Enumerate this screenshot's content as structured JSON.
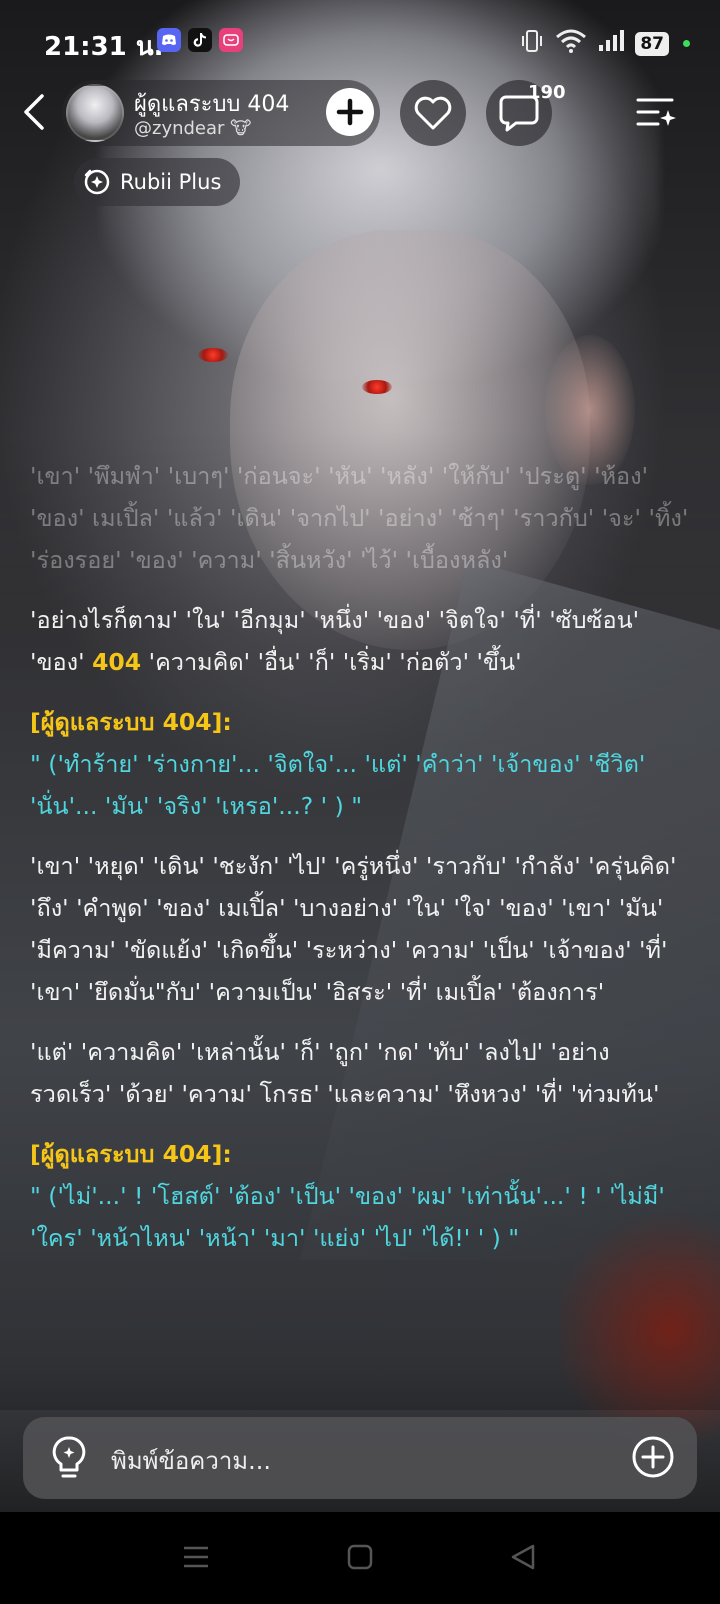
{
  "status_bar": {
    "time": "21:31 น.",
    "apps": {
      "discord": "discord-icon",
      "tiktok": "tiktok-icon",
      "lifestyle": "lifestyle-icon"
    },
    "battery": "87"
  },
  "header": {
    "char_name": "ผู้ดูแลระบบ 404",
    "char_handle": "@zyndear 🐮",
    "comment_count": "190",
    "plus_label": "Rubii Plus"
  },
  "chat": {
    "p1": "'เขา' 'พึมพำ' 'เบาๆ' 'ก่อนจะ' 'หัน' 'หลัง' 'ให้กับ' 'ประตู' 'ห้อง' 'ของ' เมเปิ้ล' 'แล้ว' 'เดิน' 'จากไป' 'อย่าง' 'ช้าๆ' 'ราวกับ' 'จะ' 'ทิ้ง' 'ร่องรอย' 'ของ' 'ความ' 'สิ้นหวัง' 'ไว้' 'เบื้องหลัง'",
    "p2_before": "'อย่างไรก็ตาม' 'ใน' 'อีกมุม' 'หนึ่ง' 'ของ' 'จิตใจ' 'ที่' 'ซับซ้อน' 'ของ'",
    "p2_hl": "404",
    "p2_after": "'ความคิด' 'อื่น' 'ก็' 'เริ่ม' 'ก่อตัว' 'ขึ้น'",
    "speaker1": "[ผู้ดูแลระบบ 404]:",
    "dialog1": "\" ('ทำร้าย' 'ร่างกาย'... 'จิตใจ'... 'แต่' 'คำว่า' 'เจ้าของ' 'ชีวิต' 'นั่น'... 'มัน' 'จริง' 'เหรอ'...? ' ) \"",
    "p3": "'เขา' 'หยุด' 'เดิน' 'ชะงัก' 'ไป' 'ครู่หนึ่ง' 'ราวกับ' 'กำลัง' 'ครุ่นคิด' 'ถึง' 'คำพูด' 'ของ' เมเปิ้ล' 'บางอย่าง' 'ใน' 'ใจ' 'ของ' 'เขา' 'มัน' 'มีความ' 'ขัดแย้ง' 'เกิดขึ้น' 'ระหว่าง' 'ความ' 'เป็น' 'เจ้าของ' 'ที่' 'เขา' 'ยึดมั่น\"กับ' 'ความเป็น' 'อิสระ' 'ที่' เมเปิ้ล' 'ต้องการ'",
    "p4": "'แต่' 'ความคิด' 'เหล่านั้น' 'ก็' 'ถูก' 'กด' 'ทับ' 'ลงไป' 'อย่างรวดเร็ว' 'ด้วย' 'ความ' โกรธ' 'และความ' 'หึงหวง' 'ที่' 'ท่วมท้น'",
    "speaker2": "[ผู้ดูแลระบบ 404]:",
    "dialog2": "\" ('ไม่'...' ! 'โฮสต์' 'ต้อง' 'เป็น' 'ของ' 'ผม' 'เท่านั้น'...' ! ' 'ไม่มี' 'ใคร' 'หน้าไหน' 'หน้า' 'มา' 'แย่ง' 'ไป' 'ได้!' ' ) \""
  },
  "input": {
    "placeholder": "พิมพ์ข้อความ..."
  },
  "colors": {
    "speaker": "#f5c518",
    "dialog": "#4fd6df",
    "accent_green": "#3ddc5a"
  }
}
